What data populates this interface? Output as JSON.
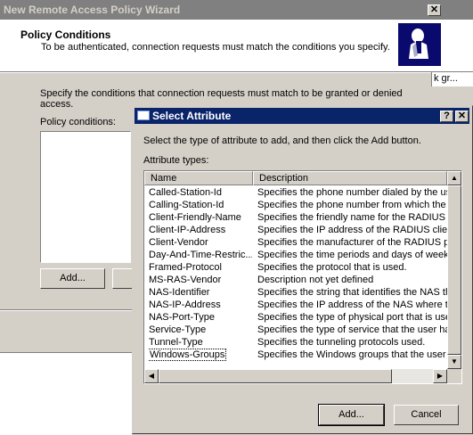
{
  "wizard": {
    "title": "New Remote Access Policy Wizard",
    "close_label": "✕",
    "header_title": "Policy Conditions",
    "header_subtitle": "To be authenticated, connection requests must match the conditions you specify.",
    "intro_line1": "Specify the conditions that connection requests must match to be granted or denied",
    "intro_line2": "access.",
    "conditions_label": "Policy conditions:",
    "add_label": "Add...",
    "right_peek": "k gr..."
  },
  "dialog": {
    "title": "Select Attribute",
    "help_label": "?",
    "close_label": "✕",
    "instruction": "Select the type of attribute to add, and then click the Add button.",
    "list_label": "Attribute types:",
    "columns": [
      "Name",
      "Description"
    ],
    "rows": [
      {
        "name": "Called-Station-Id",
        "desc": "Specifies the phone number dialed by the use"
      },
      {
        "name": "Calling-Station-Id",
        "desc": "Specifies the phone number from which the c"
      },
      {
        "name": "Client-Friendly-Name",
        "desc": "Specifies the friendly name for the RADIUS c"
      },
      {
        "name": "Client-IP-Address",
        "desc": "Specifies the IP address of the RADIUS clier"
      },
      {
        "name": "Client-Vendor",
        "desc": "Specifies the manufacturer of the RADIUS pi"
      },
      {
        "name": "Day-And-Time-Restric...",
        "desc": "Specifies the time periods and days of week"
      },
      {
        "name": "Framed-Protocol",
        "desc": "Specifies the protocol that is used."
      },
      {
        "name": "MS-RAS-Vendor",
        "desc": "Description not yet defined"
      },
      {
        "name": "NAS-Identifier",
        "desc": "Specifies the string that identifies the NAS th"
      },
      {
        "name": "NAS-IP-Address",
        "desc": "Specifies the IP address of the NAS where th"
      },
      {
        "name": "NAS-Port-Type",
        "desc": "Specifies the type of physical port that is use"
      },
      {
        "name": "Service-Type",
        "desc": "Specifies the type of service that the user ha"
      },
      {
        "name": "Tunnel-Type",
        "desc": "Specifies the tunneling protocols used."
      },
      {
        "name": "Windows-Groups",
        "desc": "Specifies the Windows groups that the user b"
      }
    ],
    "selected_index": 13,
    "add_label": "Add...",
    "cancel_label": "Cancel"
  },
  "colors": {
    "dialog_titlebar": "#0a246a",
    "inactive_titlebar": "#808080",
    "face": "#d4d0c8"
  }
}
